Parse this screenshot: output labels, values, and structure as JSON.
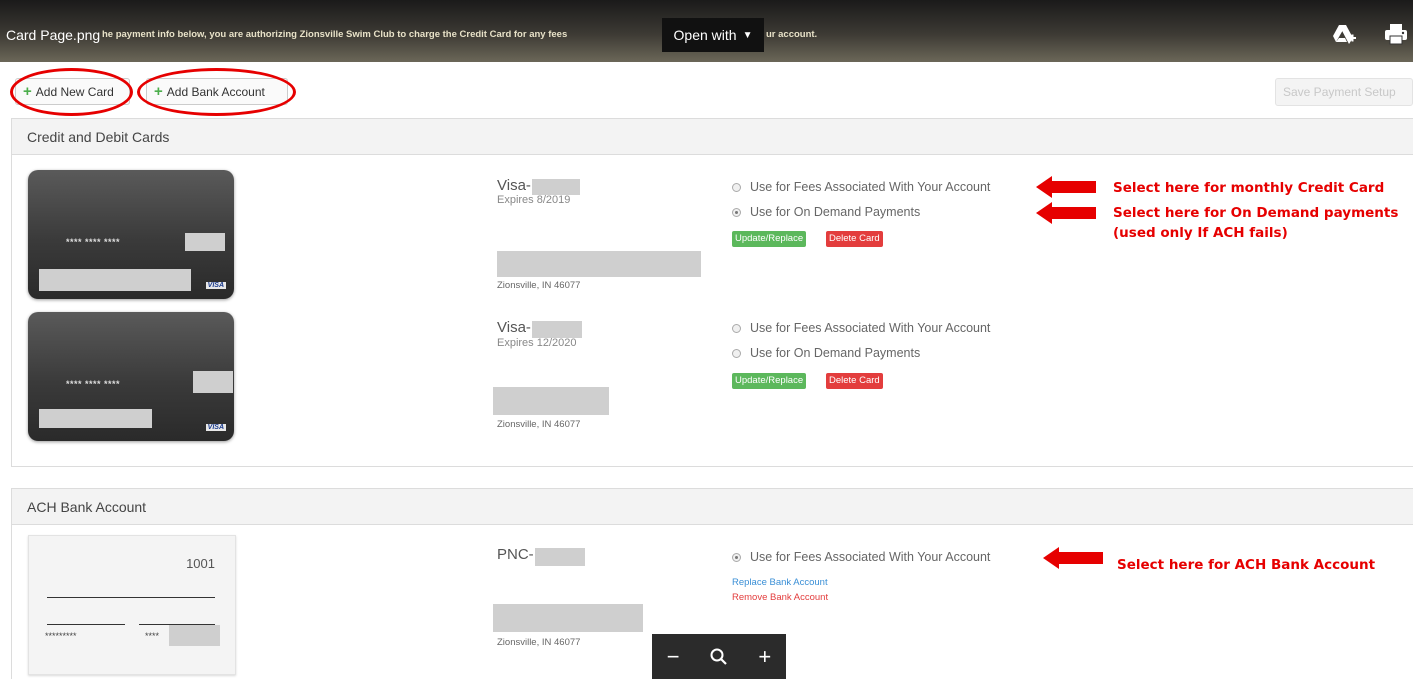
{
  "viewer": {
    "file_title": "Card Page.png",
    "auth_text_left": "he payment info below, you are authorizing Zionsville Swim Club to charge the Credit Card for any fees",
    "auth_text_right": "ur account.",
    "open_with_label": "Open with",
    "icons": [
      "drive-add-icon",
      "print-icon"
    ]
  },
  "toolbar": {
    "add_card_label": "Add New Card",
    "add_bank_label": "Add Bank Account",
    "save_label": "Save Payment Setup"
  },
  "cards_section": {
    "title": "Credit and Debit Cards",
    "cards": [
      {
        "masked_number": "**** **** ****",
        "network_badge": "VISA",
        "brand": "Visa-",
        "expires": "Expires 8/2019",
        "city": "Zionsville, IN 46077",
        "option_fees": "Use for Fees Associated With Your Account",
        "option_fees_selected": false,
        "option_ondemand": "Use for On Demand Payments",
        "option_ondemand_selected": true,
        "update_label": "Update/Replace",
        "delete_label": "Delete Card"
      },
      {
        "masked_number": "**** **** ****",
        "network_badge": "VISA",
        "brand": "Visa-",
        "expires": "Expires 12/2020",
        "city": "Zionsville, IN 46077",
        "option_fees": "Use for Fees Associated With Your Account",
        "option_fees_selected": false,
        "option_ondemand": "Use for On Demand Payments",
        "option_ondemand_selected": false,
        "update_label": "Update/Replace",
        "delete_label": "Delete Card"
      }
    ]
  },
  "ach_section": {
    "title": "ACH Bank Account",
    "check_number": "1001",
    "routing_masked": "*********",
    "account_masked": "****",
    "brand": "PNC-",
    "city": "Zionsville, IN 46077",
    "option_fees": "Use for Fees Associated With Your Account",
    "option_fees_selected": true,
    "replace_label": "Replace Bank Account",
    "remove_label": "Remove Bank Account"
  },
  "annotations": {
    "monthly": "Select here for monthly Credit Card",
    "ondemand_1": "Select here for On Demand payments",
    "ondemand_2": "(used only If ACH fails)",
    "ach": "Select here for ACH Bank Account",
    "color": "#e60000"
  },
  "zoom": {
    "minus": "−",
    "plus": "+"
  }
}
